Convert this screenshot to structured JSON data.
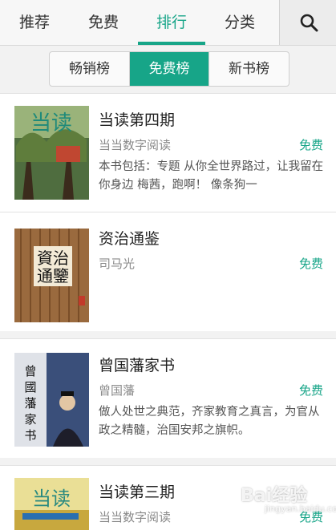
{
  "tabs": [
    "推荐",
    "免费",
    "排行",
    "分类"
  ],
  "segments": [
    "畅销榜",
    "免费榜",
    "新书榜"
  ],
  "books": [
    {
      "title": "当读第四期",
      "author": "当当数字阅读",
      "price": "免费",
      "desc": "本书包括：专题 从你全世界路过，让我留在你身边 梅茜，跑啊！ 像条狗一",
      "cover_text": "当读"
    },
    {
      "title": "资治通鉴",
      "author": "司马光",
      "price": "免费",
      "desc": "",
      "cover_text": "資治通鑒"
    },
    {
      "title": "曾国藩家书",
      "author": "曾国藩",
      "price": "免费",
      "desc": "做人处世之典范，齐家教育之真言，为官从政之精髓，治国安邦之旗帜。",
      "cover_text": "曾國藩家书"
    },
    {
      "title": "当读第三期",
      "author": "当当数字阅读",
      "price": "免费",
      "desc": "",
      "cover_text": "当读"
    }
  ],
  "watermark": {
    "brand": "Bai经验",
    "url": "jingyan.baidu.com"
  },
  "colors": {
    "accent": "#17a588"
  }
}
